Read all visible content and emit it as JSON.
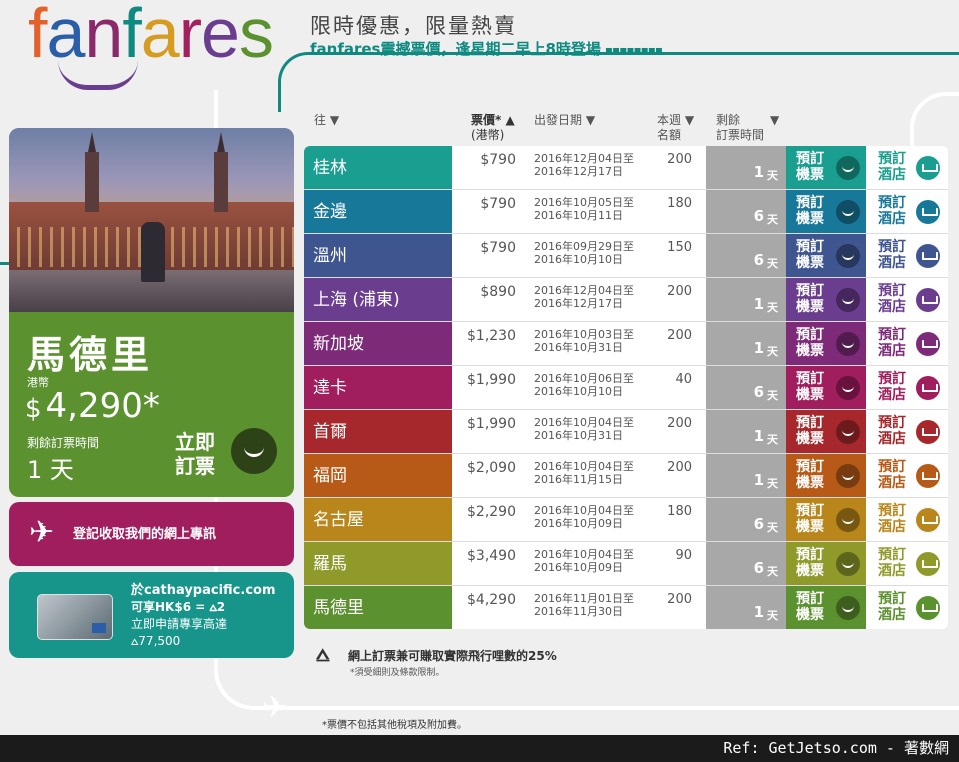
{
  "brand": {
    "logo_letters": [
      "f",
      "a",
      "n",
      "f",
      "a",
      "r",
      "e",
      "s"
    ],
    "logo_colors": [
      "#e3622c",
      "#2b5ea8",
      "#8a2a6b",
      "#0f8a80",
      "#d69b21",
      "#a31f5d",
      "#6a3d8f",
      "#5c9130"
    ]
  },
  "headline": {
    "title": "限時優惠，限量熱賣",
    "subtitle": "fanfares震撼票價，逢星期二早上8時登場",
    "dots": "▪▪▪▪▪▪▪▪"
  },
  "promo": {
    "city": "馬德里",
    "currency_label": "港幣",
    "currency_symbol": "$",
    "price": "4,290*",
    "remaining_label": "剩餘訂票時間",
    "remaining": "1 天",
    "book_now": "立即\n訂票"
  },
  "newsletter": {
    "label": "登記收取我們的網上專訊"
  },
  "card_promo": {
    "line1": "於cathaypacific.com",
    "line2": "可享HK$6 = ⩟2",
    "line3": "立即申請專享高達",
    "line4": "⩟77,500"
  },
  "table": {
    "headers": {
      "dest": "往 ▼",
      "fare": "票價* ▲",
      "fare_sub": "(港幣)",
      "dates": "出發日期 ▼",
      "quota": "本週",
      "quota2": "名額",
      "quota_arrow": "▼",
      "remain": "剩餘",
      "remain2": "訂票時間",
      "remain_arrow": "▼"
    },
    "book_flight_label": "預訂\n機票",
    "book_hotel_label": "預訂\n酒店",
    "days_unit": "天",
    "rows": [
      {
        "dest": "桂林",
        "fare": "$790",
        "date_from": "2016年12月04日至",
        "date_to": "2016年12月17日",
        "quota": "200",
        "days": "1",
        "color": "#1a9e8f"
      },
      {
        "dest": "金邊",
        "fare": "$790",
        "date_from": "2016年10月05日至",
        "date_to": "2016年10月11日",
        "quota": "180",
        "days": "6",
        "color": "#18789a"
      },
      {
        "dest": "溫州",
        "fare": "$790",
        "date_from": "2016年09月29日至",
        "date_to": "2016年10月10日",
        "quota": "150",
        "days": "6",
        "color": "#3e5590"
      },
      {
        "dest": "上海 (浦東)",
        "fare": "$890",
        "date_from": "2016年12月04日至",
        "date_to": "2016年12月17日",
        "quota": "200",
        "days": "1",
        "color": "#6a3d8f"
      },
      {
        "dest": "新加坡",
        "fare": "$1,230",
        "date_from": "2016年10月03日至",
        "date_to": "2016年10月31日",
        "quota": "200",
        "days": "1",
        "color": "#7d2a78"
      },
      {
        "dest": "達卡",
        "fare": "$1,990",
        "date_from": "2016年10月06日至",
        "date_to": "2016年10月10日",
        "quota": "40",
        "days": "6",
        "color": "#a01d5e"
      },
      {
        "dest": "首爾",
        "fare": "$1,990",
        "date_from": "2016年10月04日至",
        "date_to": "2016年10月31日",
        "quota": "200",
        "days": "1",
        "color": "#a6282c"
      },
      {
        "dest": "福岡",
        "fare": "$2,090",
        "date_from": "2016年10月04日至",
        "date_to": "2016年11月15日",
        "quota": "200",
        "days": "1",
        "color": "#b85a17"
      },
      {
        "dest": "名古屋",
        "fare": "$2,290",
        "date_from": "2016年10月04日至",
        "date_to": "2016年10月09日",
        "quota": "180",
        "days": "6",
        "color": "#b8861b"
      },
      {
        "dest": "羅馬",
        "fare": "$3,490",
        "date_from": "2016年10月04日至",
        "date_to": "2016年10月09日",
        "quota": "90",
        "days": "6",
        "color": "#8f9a2a"
      },
      {
        "dest": "馬德里",
        "fare": "$4,290",
        "date_from": "2016年11月01日至",
        "date_to": "2016年11月30日",
        "quota": "200",
        "days": "1",
        "color": "#5c9130"
      }
    ]
  },
  "miles": {
    "icon": "asia-miles-icon",
    "text": "網上訂票兼可賺取實際飛行哩數的25%",
    "sub": "*須受細則及條款限制。"
  },
  "fine_print": "*票價不包括其他稅項及附加費。",
  "footer": {
    "ref": "Ref: GetJetso.com - 著數網"
  }
}
